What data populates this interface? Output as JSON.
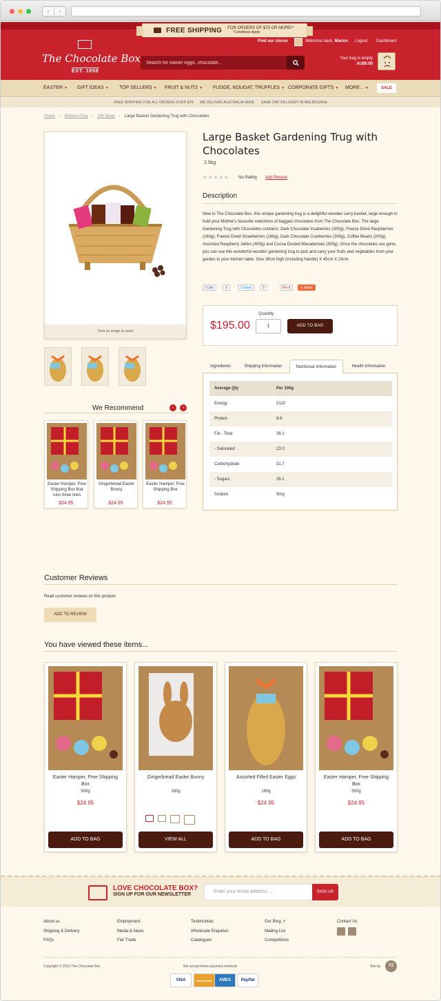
{
  "browser": {
    "controls": [
      "red",
      "yellow",
      "green"
    ]
  },
  "promo": {
    "title": "FREE SHIPPING",
    "detail": "FOR ORDERS OF $75 OR MORE!*",
    "conditions": "*Conditions Apply"
  },
  "brand": {
    "name": "The Chocolate Box",
    "established": "EST. 1958"
  },
  "search": {
    "placeholder": "Search for easter eggs, chocolate..."
  },
  "top_links": {
    "find_stores": "Find our stores",
    "welcome": "Welcome back, ",
    "user": "Marion",
    "logout": "Logout",
    "dashboard": "Dashboard"
  },
  "bag": {
    "status": "Your bag is empty",
    "total": "AU$0.00"
  },
  "nav": {
    "items": [
      "EASTER",
      "GIFT IDEAS",
      "TOP SELLERS",
      "FRUIT & NUTS",
      "FUDGE, NOUGAT, TRUFFLES",
      "CORPORATE GIFTS",
      "MORE..."
    ],
    "sale": "SALE"
  },
  "strip": {
    "text": "FREE SHIPPING FOR ALL ORDERS OVER $75.     WE DELIVER AUSTRALIA WIDE.     SAME DAY DELIVERY IN MELBOURNE."
  },
  "breadcrumb": [
    "Home",
    "Mothers Day",
    "Gift Ideas",
    "Large Basket Gardening Trug with Chocolates"
  ],
  "product": {
    "title": "Large Basket Gardening Trug with Chocolates",
    "weight": "2.5kg",
    "rating_text": "No Rating",
    "add_review": "Add Review",
    "zoom_hint": "Click on image to zoom",
    "description_title": "Description",
    "description": "New to The Chocolate Box, this unique gardening trug is a delightful wooden carry basket, large enough to hold your Mother's favourite selections of bagged chocolates from The Chocolate Box. The large Gardening Trug with Chocolates contains: Dark Chocolate Incaberries (300g), Freeze Dried Raspberries (160g), Freeze Dried Strawberries (160g), Dark Chocolate Cranberries (300g), Coffee Beans (200g), Assorted Raspberry Jellies (400g) and Cocoa Dusted Macadamias (300g). Once the chocolates are gone, you can use this wonderful wooden gardening trug to pick and carry your fruits and vegetables from your garden to your kitchen table. Size 28cm high (including handle) X 45cm X 24cm.",
    "price": "$195.00",
    "quantity_label": "Quantity",
    "quantity": "1",
    "add_to_bag": "ADD TO BAG"
  },
  "share": {
    "like": "Like",
    "like_count": "0",
    "tweet": "Tweet",
    "tweet_count": "0",
    "pin": "Pin it",
    "share": "Share"
  },
  "tabs": [
    "Ingredients",
    "Shipping Information",
    "Nutritional Information",
    "Health Information"
  ],
  "nutrition": {
    "headers": [
      "Average Qty",
      "Per 100g"
    ],
    "rows": [
      [
        "Energy",
        "2110"
      ],
      [
        "Protein",
        "8.8"
      ],
      [
        "Fat - Total",
        "38.1"
      ],
      [
        "- Saturated",
        "23.0"
      ],
      [
        "Carbohydrate",
        "31.7"
      ],
      [
        "- Sugars",
        "26.1"
      ],
      [
        "Sodium",
        "9mg"
      ]
    ]
  },
  "recommend": {
    "title": "We Recommend",
    "items": [
      {
        "name": "Easter Hamper, Free Shipping Box that runs three lines",
        "price": "$24.95"
      },
      {
        "name": "Gingerbread Easter Bunny",
        "price": "$24.95"
      },
      {
        "name": "Easter Hamper, Free Shipping Box",
        "price": "$24.95"
      }
    ]
  },
  "reviews": {
    "title": "Customer Reviews",
    "text": "Read customer reviews on this product",
    "button": "ADD TO REVIEW"
  },
  "viewed": {
    "title": "You have viewed these items...",
    "items": [
      {
        "name": "Easter Hamper, Free Shipping Box",
        "weight": "500g",
        "price": "$24.95",
        "button": "ADD TO BAG"
      },
      {
        "name": "Gingerbread Easter Bunny",
        "weight": "160g",
        "price": "",
        "button": "VIEW ALL"
      },
      {
        "name": "Assorted Filled Easter Eggs",
        "weight": "160g",
        "price": "$24.95",
        "button": "ADD TO BAG"
      },
      {
        "name": "Easter Hamper, Free Shipping Box",
        "weight": "500g",
        "price": "$24.95",
        "button": "ADD TO BAG"
      }
    ]
  },
  "newsletter": {
    "title": "LOVE CHOCOLATE BOX?",
    "subtitle": "SIGN UP FOR OUR NEWSLETTER",
    "placeholder": "Enter your email address....",
    "button": "SIGN UP"
  },
  "footer": {
    "col1": [
      "About us",
      "Shipping & Delivery",
      "FAQs"
    ],
    "col2": [
      "Employment",
      "Media & News",
      "Fair Trade"
    ],
    "col3": [
      "Testimonials",
      "Wholesale Enquiries",
      "Catalogues"
    ],
    "col4": [
      "Our Blog",
      "Mailing List",
      "Competitions"
    ],
    "contact": "Contact Us",
    "copyright": "Copyright © 2013 The Chocolate Box",
    "payment_label": "We accept these payment methods",
    "site_by": "Site by",
    "site_by_logo": "TZ",
    "cards": [
      "VISA",
      "MasterCard",
      "AMEX",
      "PayPal"
    ]
  }
}
